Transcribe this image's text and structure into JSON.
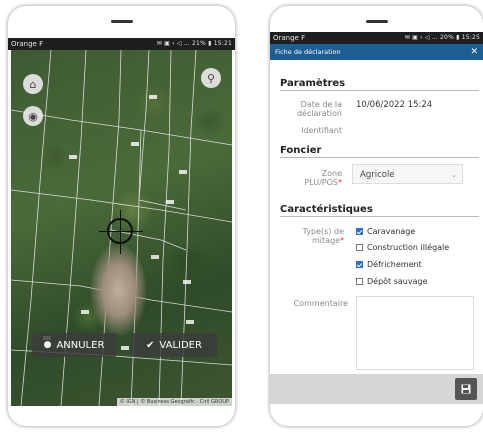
{
  "left_screen": {
    "status": {
      "carrier": "Orange F",
      "icons": "✉ ▣ ‹ ◁ … 21% ▮ 15:21"
    },
    "icons": {
      "home": "home-icon",
      "marker": "map-marker-icon",
      "search": "zoom-icon"
    },
    "buttons": {
      "cancel": "ANNULER",
      "validate": "VALIDER"
    },
    "attribution": "© IGN | © Business Geografic - Ciril GROUP"
  },
  "right_screen": {
    "status": {
      "carrier": "Orange F",
      "icons": "✉ ▣ ‹ ◁ … 20% ▮ 15:25"
    },
    "header": {
      "title": "Fiche de déclaration",
      "close": "✕"
    },
    "sections": {
      "parametres": "Paramètres",
      "foncier": "Foncier",
      "caracteristiques": "Caractéristiques"
    },
    "fields": {
      "date_label": "Date de la déclaration",
      "date_value": "10/06/2022 15:24",
      "id_label": "Identifiant",
      "zone_label": "Zone PLU/POS",
      "zone_value": "Agricole",
      "types_label": "Type(s) de mitage",
      "comment_label": "Commentaire",
      "required_mark": "*"
    },
    "checkboxes": [
      {
        "label": "Caravanage",
        "checked": true
      },
      {
        "label": "Construction illégale",
        "checked": false
      },
      {
        "label": "Défrichement",
        "checked": true
      },
      {
        "label": "Dépôt sauvage",
        "checked": false
      }
    ],
    "save_icon": "save-icon",
    "accent_color": "#1f5e91"
  }
}
